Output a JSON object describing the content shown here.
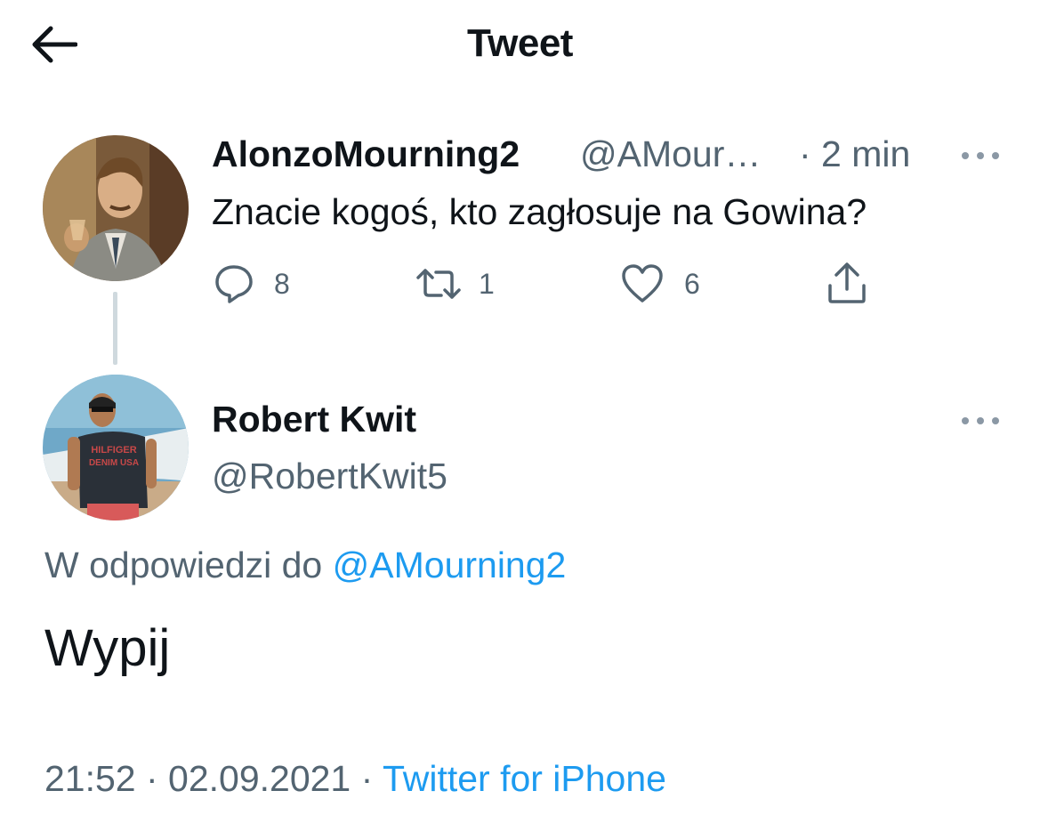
{
  "header": {
    "title": "Tweet",
    "back_icon": "arrow-left-icon"
  },
  "parent_tweet": {
    "display_name": "AlonzoMourning2",
    "handle": "@AMour…",
    "time": "· 2 min",
    "text": "Znacie kogoś, kto zagłosuje na Gowina?",
    "actions": {
      "replies": "8",
      "retweets": "1",
      "likes": "6"
    },
    "icons": [
      "comment-icon",
      "retweet-icon",
      "heart-icon",
      "share-icon",
      "more-icon"
    ]
  },
  "reply_tweet": {
    "display_name": "Robert Kwit",
    "handle": "@RobertKwit5",
    "reply_prefix": "W odpowiedzi do",
    "reply_mention": "@AMourning2",
    "text": "Wypij",
    "timestamp": "21:52 · 02.09.2021 ·",
    "source": "Twitter for iPhone",
    "shirt_text": "HILFIGER DENIM USA"
  },
  "colors": {
    "text_primary": "#0f1419",
    "text_secondary": "#536471",
    "link": "#1d9bf0",
    "thread_line": "#cfd9de"
  }
}
